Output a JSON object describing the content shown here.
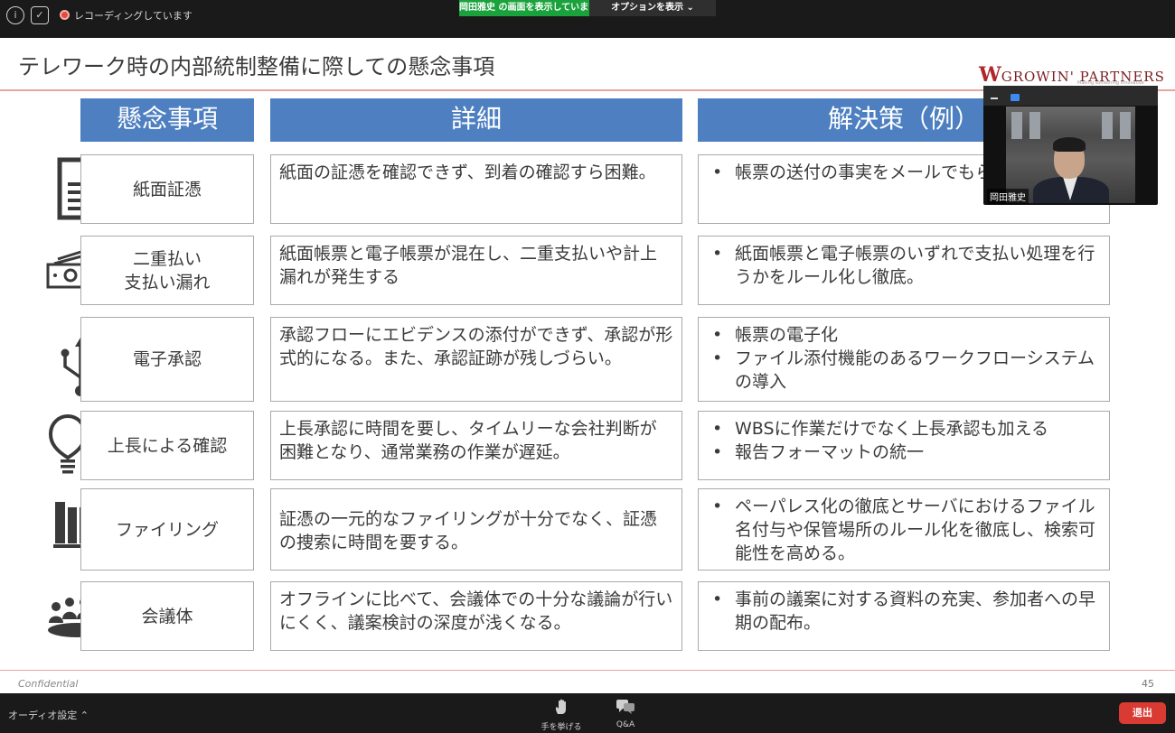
{
  "topbar": {
    "recording_label": "レコーディングしています",
    "viewing_banner": "岡田雅史 の画面を表示しています",
    "view_options": "オプションを表示"
  },
  "slide": {
    "title": "テレワーク時の内部統制整備に際しての懸念事項",
    "logo": {
      "mark": "W",
      "text": "GROWIN' PARTNERS",
      "tagline": "Making something innovative"
    },
    "headers": {
      "concern": "懸念事項",
      "detail": "詳細",
      "solution": "解決策（例）"
    },
    "rows": [
      {
        "icon": "document-icon",
        "concern": "紙面証憑",
        "detail": "紙面の証憑を確認できず、到着の確認すら困難。",
        "solutions": [
          "帳票の送付の事実をメールでもらう。"
        ]
      },
      {
        "icon": "money-icon",
        "concern": "二重払い\n支払い漏れ",
        "detail": "紙面帳票と電子帳票が混在し、二重支払いや計上漏れが発生する",
        "solutions": [
          "紙面帳票と電子帳票のいずれで支払い処理を行うかをルール化し徹底。"
        ]
      },
      {
        "icon": "usb-icon",
        "concern": "電子承認",
        "detail": "承認フローにエビデンスの添付ができず、承認が形式的になる。また、承認証跡が残しづらい。",
        "solutions": [
          "帳票の電子化",
          "ファイル添付機能のあるワークフローシステムの導入"
        ]
      },
      {
        "icon": "lightbulb-icon",
        "concern": "上長による確認",
        "detail": "上長承認に時間を要し、タイムリーな会社判断が困難となり、通常業務の作業が遅延。",
        "solutions": [
          "WBSに作業だけでなく上長承認も加える",
          "報告フォーマットの統一"
        ]
      },
      {
        "icon": "binders-icon",
        "concern": "ファイリング",
        "detail": "証憑の一元的なファイリングが十分でなく、証憑の捜索に時間を要する。",
        "solutions": [
          "ペーパレス化の徹底とサーバにおけるファイル名付与や保管場所のルール化を徹底し、検索可能性を高める。"
        ]
      },
      {
        "icon": "meeting-icon",
        "concern": "会議体",
        "detail": "オフラインに比べて、会議体での十分な議論が行いにくく、議案検討の深度が浅くなる。",
        "solutions": [
          "事前の議案に対する資料の充実、参加者への早期の配布。"
        ]
      }
    ],
    "footer": {
      "confidential": "Confidential",
      "page": "45"
    }
  },
  "video": {
    "participant_name": "岡田雅史"
  },
  "bottombar": {
    "audio_settings": "オーディオ設定",
    "raise_hand": "手を挙げる",
    "qa": "Q&A",
    "leave": "退出"
  }
}
